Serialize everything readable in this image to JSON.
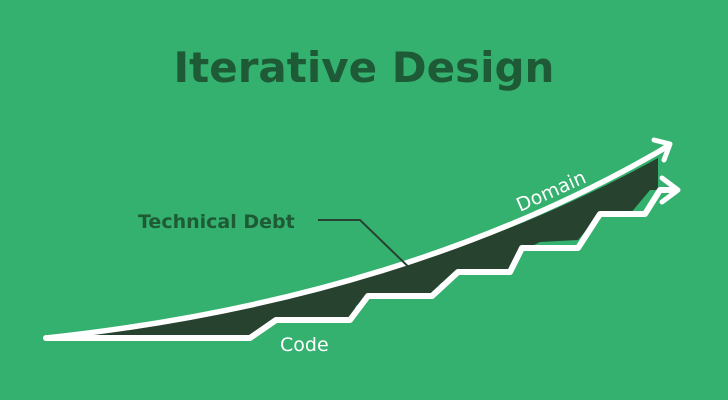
{
  "diagram": {
    "title": "Iterative Design",
    "labels": {
      "domain": "Domain",
      "code": "Code",
      "technical_debt": "Technical Debt"
    },
    "colors": {
      "background": "#34b06f",
      "title": "#1d5a35",
      "technical_debt_label": "#1d5a35",
      "line": "#ffffff",
      "debt_fill": "#27432f",
      "callout": "#27432f",
      "label_text": "#ffffff"
    }
  }
}
